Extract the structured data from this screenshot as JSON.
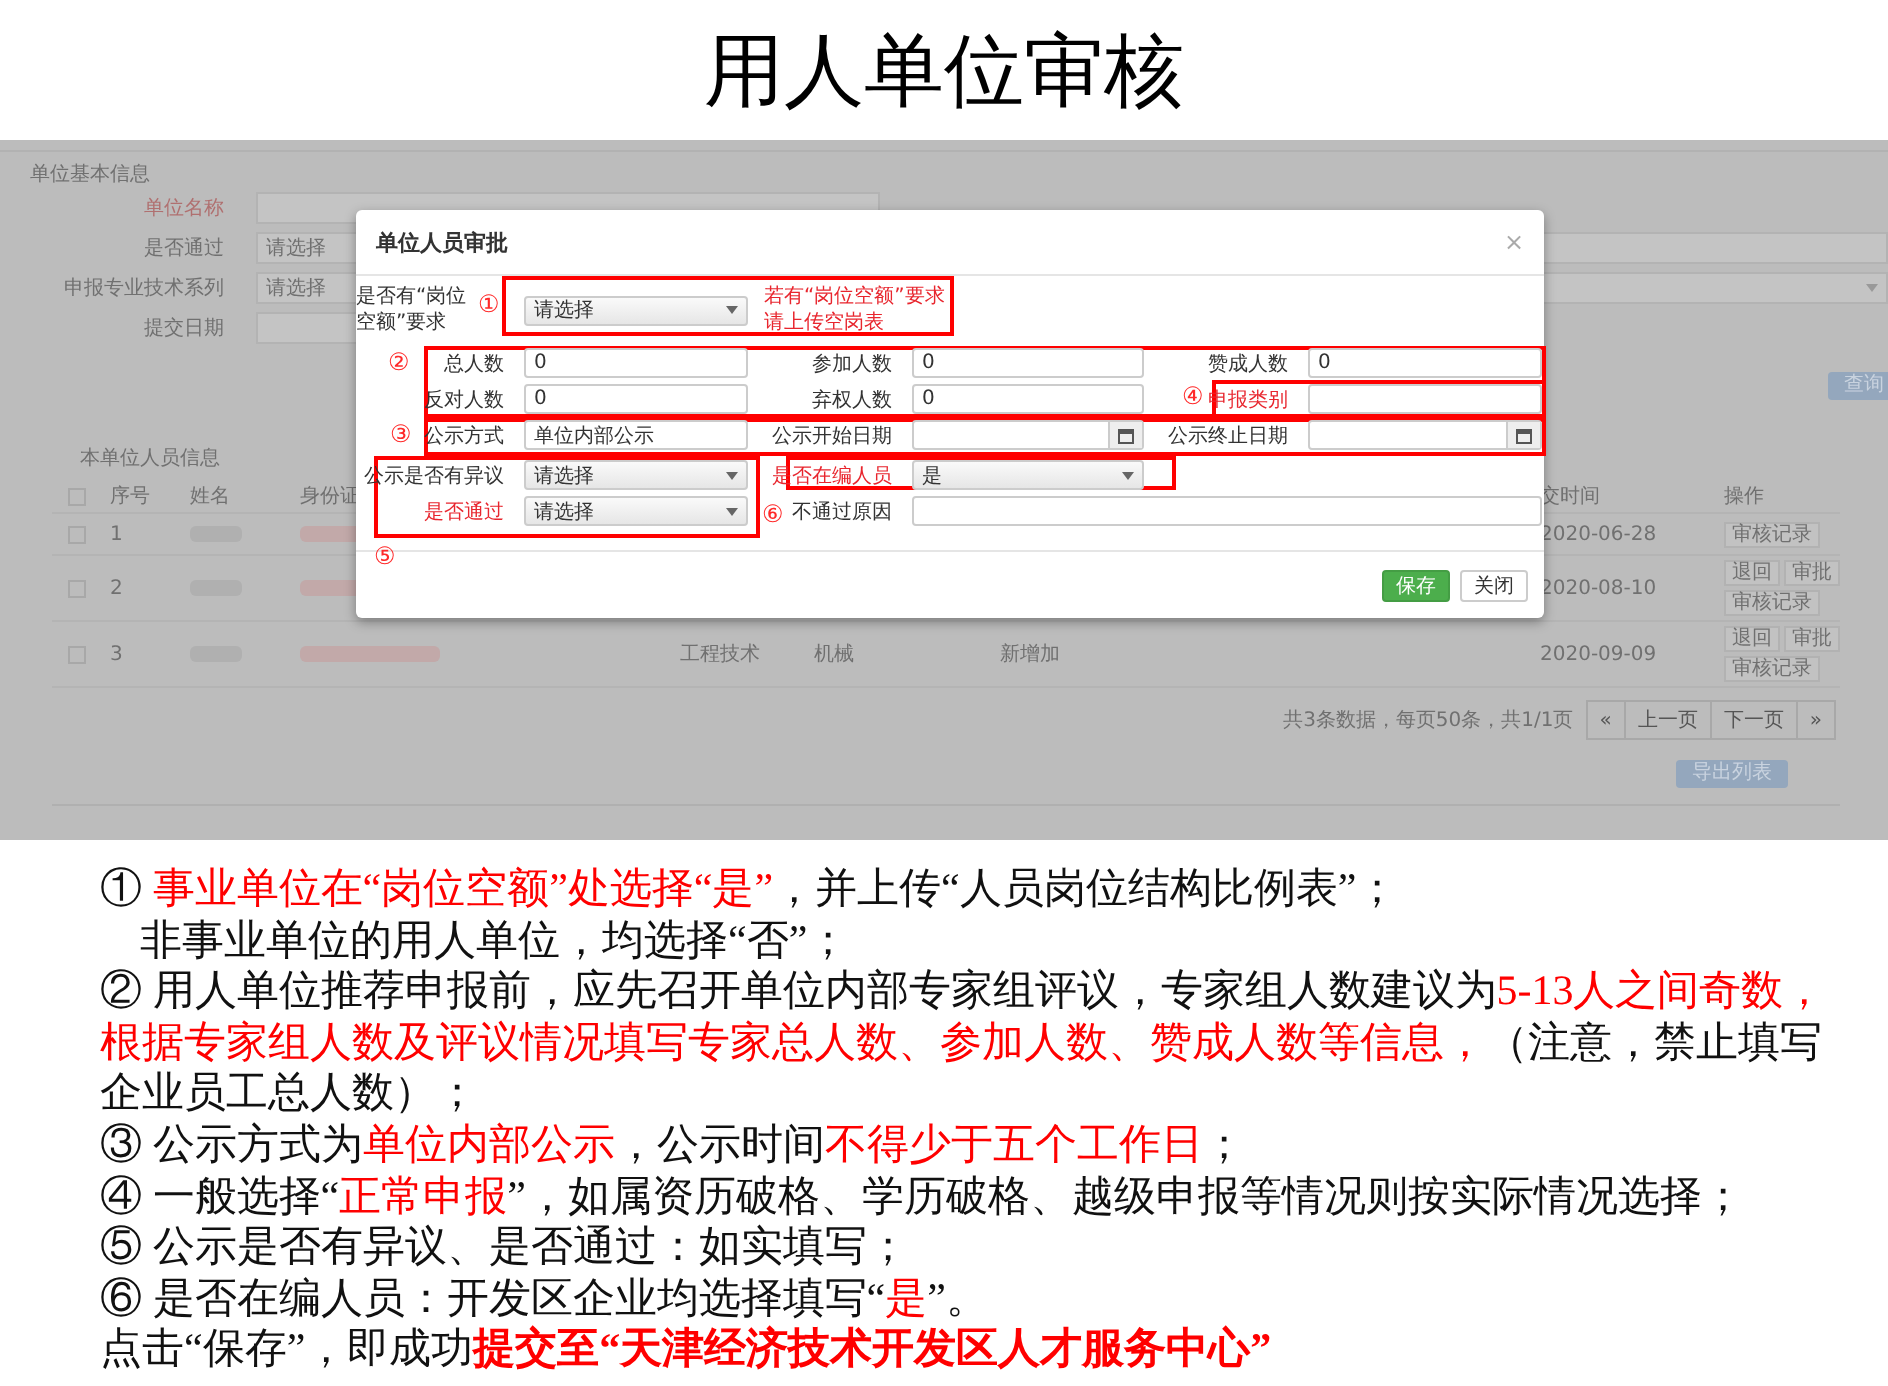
{
  "slide_title": "用人单位审核",
  "background_page": {
    "section_title": "单位基本信息",
    "form": [
      {
        "label": "单位名称",
        "highlighted": true,
        "kind": "text"
      },
      {
        "label": "是否通过",
        "highlighted": false,
        "kind": "select",
        "value": "请选择",
        "right_field": {
          "kind": "text"
        }
      },
      {
        "label": "申报专业技术系列",
        "highlighted": false,
        "kind": "select",
        "value": "请选择",
        "right_field": {
          "kind": "select"
        }
      },
      {
        "label": "提交日期",
        "highlighted": false,
        "kind": "text"
      }
    ],
    "search_button": "查询",
    "table_title": "本单位人员信息",
    "columns": {
      "checked": false,
      "no": "序号",
      "name": "姓名",
      "id": "身份证",
      "date": "交时间",
      "actions": "操作"
    },
    "rows": [
      {
        "checked": false,
        "no": "1",
        "date": "2020-06-28",
        "actions": [
          "审核记录"
        ]
      },
      {
        "checked": false,
        "no": "2",
        "date": "2020-08-10",
        "actions": [
          "退回",
          "审批",
          "审核记录"
        ]
      },
      {
        "checked": false,
        "no": "3",
        "column_6": "工程技术",
        "column_7": "机械",
        "column_8": "新增加",
        "date": "2020-09-09",
        "actions": [
          "退回",
          "审批",
          "审核记录"
        ]
      }
    ],
    "pagination": {
      "summary": "共3条数据，每页50条，共1/1页",
      "buttons": [
        "«",
        "上一页",
        "下一页",
        "»"
      ]
    },
    "export_button": "导出列表"
  },
  "dialog": {
    "title": "单位人员审批",
    "close": "×",
    "rows": [
      [
        {
          "kind": "select",
          "label": "是否有“岗位空额”要求",
          "highlighted": false,
          "value": "请选择"
        },
        {
          "kind": "note",
          "text": "若有“岗位空额”要求请上传空岗表"
        }
      ],
      [
        {
          "kind": "text",
          "label": "总人数",
          "highlighted": false,
          "value": "0"
        },
        {
          "kind": "text",
          "label": "参加人数",
          "highlighted": false,
          "value": "0"
        },
        {
          "kind": "text",
          "label": "赞成人数",
          "highlighted": false,
          "value": "0"
        }
      ],
      [
        {
          "kind": "text",
          "label": "反对人数",
          "highlighted": false,
          "value": "0"
        },
        {
          "kind": "text",
          "label": "弃权人数",
          "highlighted": false,
          "value": "0"
        },
        {
          "kind": "text",
          "label": "申报类别",
          "highlighted": true
        }
      ],
      [
        {
          "kind": "text",
          "label": "公示方式",
          "highlighted": false,
          "value": "单位内部公示"
        },
        {
          "kind": "date",
          "label": "公示开始日期",
          "highlighted": false
        },
        {
          "kind": "date",
          "label": "公示终止日期",
          "highlighted": false
        }
      ],
      [
        {
          "kind": "select",
          "label": "公示是否有异议",
          "highlighted": false,
          "value": "请选择"
        },
        {
          "kind": "select",
          "label": "是否在编人员",
          "value": "是",
          "highlighted": true
        }
      ],
      [
        {
          "kind": "select",
          "label": "是否通过",
          "value": "请选择",
          "highlighted": true
        },
        {
          "kind": "wide",
          "label": "不通过原因",
          "highlighted": false
        }
      ]
    ],
    "buttons": [
      {
        "label": "保存",
        "kind": "primary"
      },
      {
        "label": "关闭",
        "kind": "default"
      }
    ]
  },
  "annotations": [
    {
      "mark": "①"
    },
    {
      "mark": "②"
    },
    {
      "mark": "③"
    },
    {
      "mark": "④"
    },
    {
      "mark": "⑤"
    },
    {
      "mark": "⑥"
    }
  ],
  "instructions": [
    [
      {
        "kind": "plain",
        "text": "① "
      },
      {
        "kind": "red",
        "text": "事业单位在“岗位空额”处选择“是”"
      },
      {
        "kind": "plain",
        "text": "，并上传“人员岗位结构比例表”；"
      }
    ],
    [
      {
        "kind": "indent",
        "text": "非事业单位的用人单位，均选择“否”；"
      }
    ],
    [
      {
        "kind": "plain",
        "text": "② 用人单位推荐申报前，应先召开单位内部专家组评议，专家组人数建议为"
      },
      {
        "kind": "red",
        "text": "5-13人之间奇数，"
      }
    ],
    [
      {
        "kind": "red",
        "text": "根据专家组人数及评议情况填写专家总人数、参加人数、赞成人数等信息，"
      },
      {
        "kind": "plain",
        "text": "（注意，禁止填写"
      }
    ],
    [
      {
        "kind": "plain",
        "text": "企业员工总人数）；"
      }
    ],
    [
      {
        "kind": "plain",
        "text": "③ 公示方式为"
      },
      {
        "kind": "red",
        "text": "单位内部公示"
      },
      {
        "kind": "plain",
        "text": "，公示时间"
      },
      {
        "kind": "red",
        "text": "不得少于五个工作日"
      },
      {
        "kind": "plain",
        "text": "；"
      }
    ],
    [
      {
        "kind": "plain",
        "text": "④ 一般选择“"
      },
      {
        "kind": "red",
        "text": "正常申报"
      },
      {
        "kind": "plain",
        "text": "”，如属资历破格、学历破格、越级申报等情况则按实际情况选择；"
      }
    ],
    [
      {
        "kind": "plain",
        "text": "⑤ 公示是否有异议、是否通过：如实填写；"
      }
    ],
    [
      {
        "kind": "plain",
        "text": "⑥ 是否在编人员：开发区企业均选择填写“"
      },
      {
        "kind": "red",
        "text": "是"
      },
      {
        "kind": "plain",
        "text": "”。"
      }
    ],
    [
      {
        "kind": "plain",
        "text": "点击“保存”，即成功"
      },
      {
        "kind": "strong",
        "text": "提交至“天津经济技术开发区人才服务中心”"
      }
    ]
  ]
}
